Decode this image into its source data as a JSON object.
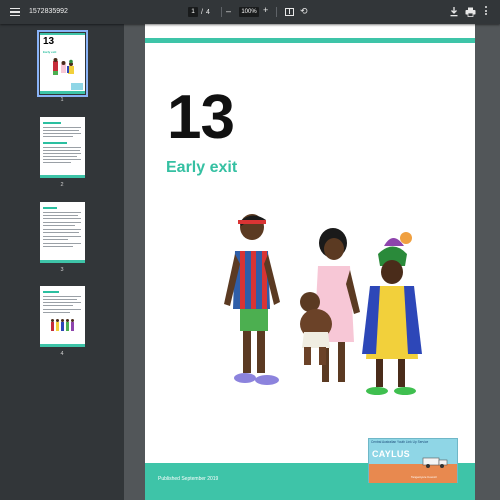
{
  "toolbar": {
    "title": "1572835992",
    "current_page": "1",
    "page_separator": "/",
    "total_pages": "4",
    "zoom_minus": "–",
    "zoom": "100%",
    "zoom_plus": "+",
    "rotate_icon": "⟲"
  },
  "sidebar": {
    "thumbnails": [
      {
        "label": "1",
        "heading": "13",
        "subheading": "Early exit"
      },
      {
        "label": "2"
      },
      {
        "label": "3"
      },
      {
        "label": "4"
      }
    ]
  },
  "document": {
    "number": "13",
    "title": "Early exit",
    "published": "Published September 2019",
    "logo": {
      "top_text": "Central Australian Youth Link Up Service",
      "name": "CAYLUS",
      "bottom_text": "Tangentyere Council"
    }
  },
  "colors": {
    "accent": "#3ec4a8",
    "title": "#35c0a2",
    "toolbar": "#323639",
    "viewer_bg": "#525659"
  }
}
